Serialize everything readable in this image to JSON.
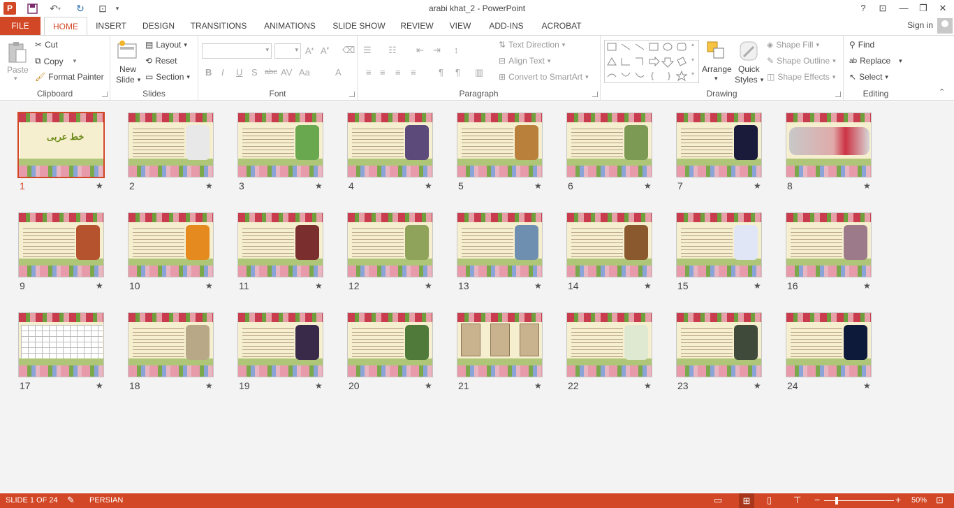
{
  "window": {
    "title": "arabi khat_2 - PowerPoint",
    "help": "?",
    "controls": [
      "ribbon-display",
      "minimize",
      "restore",
      "close"
    ]
  },
  "tabs": [
    "FILE",
    "HOME",
    "INSERT",
    "DESIGN",
    "TRANSITIONS",
    "ANIMATIONS",
    "SLIDE SHOW",
    "REVIEW",
    "VIEW",
    "ADD-INS",
    "ACROBAT"
  ],
  "active_tab": "HOME",
  "account": {
    "signin": "Sign in"
  },
  "ribbon": {
    "clipboard": {
      "label": "Clipboard",
      "paste": "Paste",
      "cut": "Cut",
      "copy": "Copy",
      "format_painter": "Format Painter"
    },
    "slides": {
      "label": "Slides",
      "new_slide_1": "New",
      "new_slide_2": "Slide",
      "layout": "Layout",
      "reset": "Reset",
      "section": "Section"
    },
    "font": {
      "label": "Font",
      "bold": "B",
      "italic": "I",
      "underline": "U",
      "shadow": "S",
      "strike": "abc",
      "case": "Aa"
    },
    "paragraph": {
      "label": "Paragraph",
      "text_direction": "Text Direction",
      "align_text": "Align Text",
      "convert_smartart": "Convert to SmartArt"
    },
    "drawing": {
      "label": "Drawing",
      "arrange": "Arrange",
      "quick_1": "Quick",
      "quick_2": "Styles",
      "shape_fill": "Shape Fill",
      "shape_outline": "Shape Outline",
      "shape_effects": "Shape Effects"
    },
    "editing": {
      "label": "Editing",
      "find": "Find",
      "replace": "Replace",
      "select": "Select"
    }
  },
  "slides": [
    {
      "n": "1",
      "kind": "title",
      "title": "خط عربی",
      "pic": ""
    },
    {
      "n": "2",
      "kind": "diagram",
      "pic": "#e8e8e8"
    },
    {
      "n": "3",
      "kind": "text",
      "pic": "#6aa84f"
    },
    {
      "n": "4",
      "kind": "text",
      "pic": "#5b4a7a"
    },
    {
      "n": "5",
      "kind": "text",
      "pic": "#b9803c"
    },
    {
      "n": "6",
      "kind": "text",
      "pic": "#7c9a54"
    },
    {
      "n": "7",
      "kind": "text",
      "pic": "#1a1a3a"
    },
    {
      "n": "8",
      "kind": "map",
      "pic": ""
    },
    {
      "n": "9",
      "kind": "text",
      "pic": "#b5532e"
    },
    {
      "n": "10",
      "kind": "text",
      "pic": "#e58a1f"
    },
    {
      "n": "11",
      "kind": "text",
      "pic": "#7a2e2e"
    },
    {
      "n": "12",
      "kind": "text",
      "pic": "#8fa35a"
    },
    {
      "n": "13",
      "kind": "text",
      "pic": "#6f8fb0"
    },
    {
      "n": "14",
      "kind": "text",
      "pic": "#8a5a2e"
    },
    {
      "n": "15",
      "kind": "text",
      "pic": "#e0e6f5"
    },
    {
      "n": "16",
      "kind": "text",
      "pic": "#9c7a8a"
    },
    {
      "n": "17",
      "kind": "grid",
      "pic": ""
    },
    {
      "n": "18",
      "kind": "text",
      "pic": "#b8a888"
    },
    {
      "n": "19",
      "kind": "text",
      "pic": "#3a2a4a"
    },
    {
      "n": "20",
      "kind": "text",
      "pic": "#4f7a3a"
    },
    {
      "n": "21",
      "kind": "scans",
      "pic": ""
    },
    {
      "n": "22",
      "kind": "text",
      "pic": "#dfe9d2"
    },
    {
      "n": "23",
      "kind": "text",
      "pic": "#3f4a3a"
    },
    {
      "n": "24",
      "kind": "text",
      "pic": "#0d1a3a"
    }
  ],
  "selected_slide": "1",
  "status": {
    "slide_info": "SLIDE 1 OF 24",
    "language": "PERSIAN",
    "zoom": "50%",
    "zoom_level": 0.5
  },
  "colors": {
    "accent": "#d24726"
  }
}
